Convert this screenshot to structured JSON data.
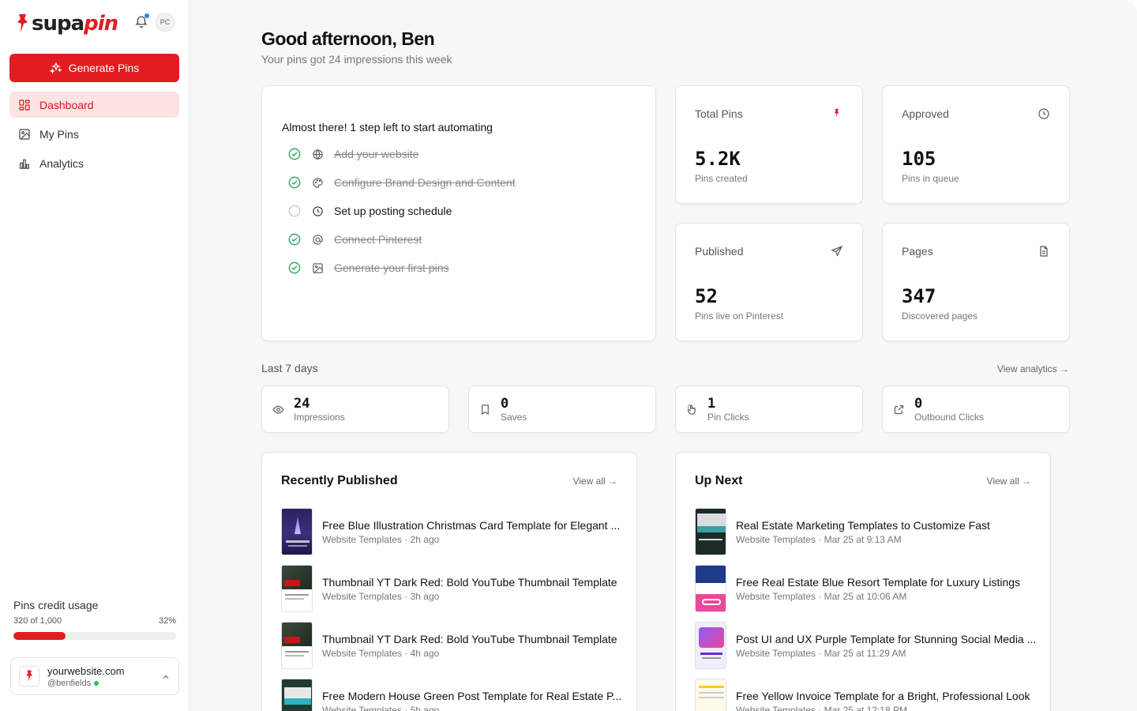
{
  "brand": {
    "name_a": "supa",
    "name_b": "pin",
    "accent": "#e11d22"
  },
  "header": {
    "avatar_initials": "PC"
  },
  "sidebar": {
    "generate_label": "Generate Pins",
    "items": [
      {
        "label": "Dashboard",
        "icon": "dashboard-icon",
        "active": true
      },
      {
        "label": "My Pins",
        "icon": "image-icon",
        "active": false
      },
      {
        "label": "Analytics",
        "icon": "chart-icon",
        "active": false
      }
    ],
    "credit": {
      "title": "Pins credit usage",
      "used_text": "320 of 1,000",
      "percent_text": "32%",
      "percent": 32
    },
    "site": {
      "name": "yourwebsite.com",
      "handle": "@benfields"
    }
  },
  "main": {
    "greeting": "Good afternoon, Ben",
    "subtitle": "Your pins got 24 impressions this week",
    "checklist": {
      "title": "Almost there! 1 step left to start automating",
      "items": [
        {
          "label": "Add your website",
          "done": true
        },
        {
          "label": "Configure Brand Design and Content",
          "done": true
        },
        {
          "label": "Set up posting schedule",
          "done": false
        },
        {
          "label": "Connect Pinterest",
          "done": true
        },
        {
          "label": "Generate your first pins",
          "done": true
        }
      ]
    },
    "stats": [
      {
        "title": "Total Pins",
        "value": "5.2K",
        "sub": "Pins created",
        "icon": "pin-icon"
      },
      {
        "title": "Approved",
        "value": "105",
        "sub": "Pins in queue",
        "icon": "clock-icon"
      },
      {
        "title": "Published",
        "value": "52",
        "sub": "Pins live on Pinterest",
        "icon": "send-icon"
      },
      {
        "title": "Pages",
        "value": "347",
        "sub": "Discovered pages",
        "icon": "document-icon"
      }
    ],
    "last7": {
      "label": "Last 7 days",
      "link": "View analytics →",
      "metrics": [
        {
          "value": "24",
          "label": "Impressions",
          "icon": "eye-icon"
        },
        {
          "value": "0",
          "label": "Saves",
          "icon": "bookmark-icon"
        },
        {
          "value": "1",
          "label": "Pin Clicks",
          "icon": "pointer-icon"
        },
        {
          "value": "0",
          "label": "Outbound Clicks",
          "icon": "external-link-icon"
        }
      ]
    },
    "recent": {
      "title": "Recently Published",
      "link": "View all →",
      "rows": [
        {
          "title": "Free Blue Illustration Christmas Card Template for Elegant ...",
          "sub": "Website Templates · 2h ago"
        },
        {
          "title": "Thumbnail YT Dark Red: Bold YouTube Thumbnail Template",
          "sub": "Website Templates · 3h ago"
        },
        {
          "title": "Thumbnail YT Dark Red: Bold YouTube Thumbnail Template",
          "sub": "Website Templates · 4h ago"
        },
        {
          "title": "Free Modern House Green Post Template for Real Estate P...",
          "sub": "Website Templates · 5h ago"
        }
      ]
    },
    "upnext": {
      "title": "Up Next",
      "link": "View all →",
      "rows": [
        {
          "title": "Real Estate Marketing Templates to Customize Fast",
          "sub": "Website Templates · Mar 25 at 9:13 AM"
        },
        {
          "title": "Free Real Estate Blue Resort Template for Luxury Listings",
          "sub": "Website Templates · Mar 25 at 10:06 AM"
        },
        {
          "title": "Post UI and UX Purple Template for Stunning Social Media ...",
          "sub": "Website Templates · Mar 25 at 11:29 AM"
        },
        {
          "title": "Free Yellow Invoice Template for a Bright, Professional Look",
          "sub": "Website Templates · Mar 25 at 12:18 PM"
        }
      ]
    }
  }
}
